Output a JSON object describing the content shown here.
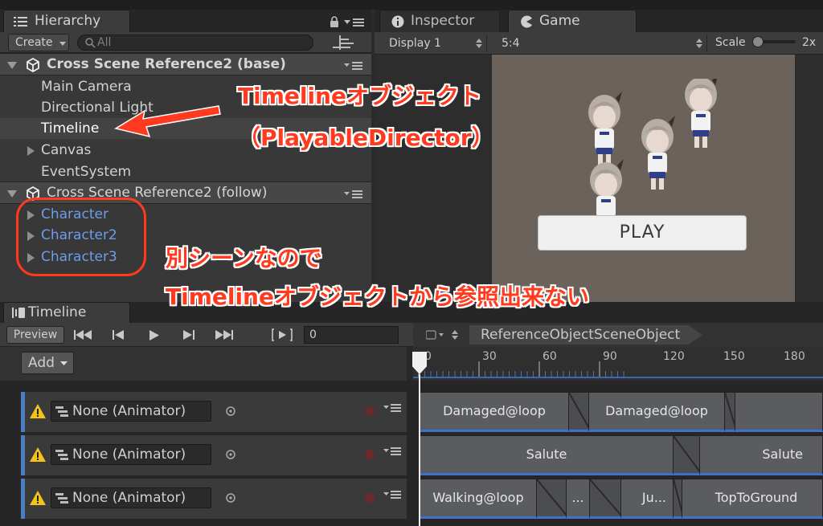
{
  "hierarchy": {
    "tab_label": "Hierarchy",
    "create_label": "Create",
    "search_placeholder": "All",
    "scenes": [
      {
        "title": "Cross Scene Reference2 (base)",
        "items": [
          "Main Camera",
          "Directional Light",
          "Timeline",
          "Canvas",
          "EventSystem"
        ]
      },
      {
        "title": "Cross Scene Reference2 (follow)",
        "items": [
          "Character",
          "Character2",
          "Character3"
        ]
      }
    ]
  },
  "inspector": {
    "tab_label": "Inspector"
  },
  "game": {
    "tab_label": "Game",
    "display": "Display 1",
    "aspect": "5:4",
    "scale_label": "Scale",
    "scale_value": "2x",
    "play_button": "PLAY"
  },
  "timeline": {
    "tab_label": "Timeline",
    "preview_label": "Preview",
    "frame_value": "0",
    "add_label": "Add",
    "director_name": "ReferenceObjectSceneObject",
    "ruler": [
      "0",
      "30",
      "60",
      "90",
      "120",
      "150",
      "180"
    ],
    "tracks": [
      {
        "binding": "None (Animator)",
        "clips": [
          "Damaged@loop",
          "Damaged@loop"
        ]
      },
      {
        "binding": "None (Animator)",
        "clips": [
          "Salute",
          "Salute"
        ]
      },
      {
        "binding": "None (Animator)",
        "clips": [
          "Walking@loop",
          "...",
          "Ju...",
          "TopToGround"
        ]
      }
    ]
  },
  "annotations": {
    "timeline_line1": "Timelineオブジェクト",
    "timeline_line2": "（PlayableDirector）",
    "other_line1": "別シーンなので",
    "other_line2": "Timelineオブジェクトから参照出来ない"
  },
  "colors": {
    "annotation": "#ff3a1e",
    "clip_underline": "#3d72c8",
    "scene_object_text": "#6f9be8"
  }
}
